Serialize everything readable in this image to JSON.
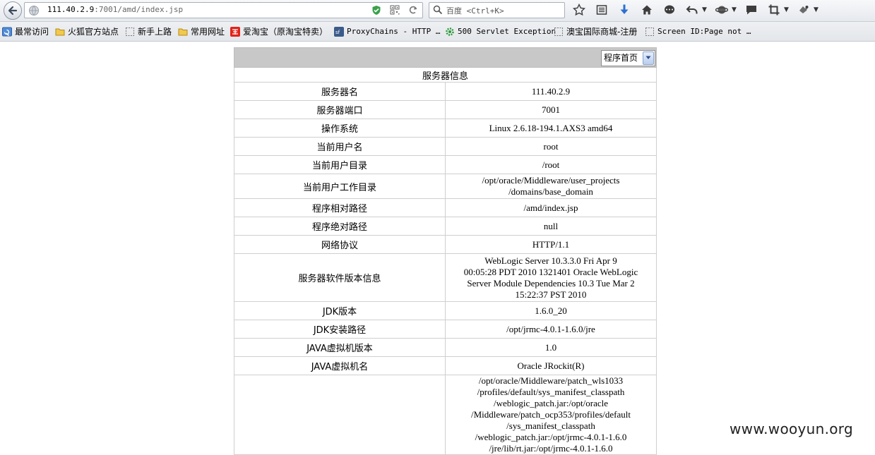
{
  "browser": {
    "url_host": "111.40.2.9",
    "url_path": ":7001/amd/index.jsp",
    "search_placeholder": "百度 <Ctrl+K>"
  },
  "bookmarks": [
    {
      "label": "最常访问",
      "icon": "bookmark-blue-icon"
    },
    {
      "label": "火狐官方站点",
      "icon": "folder-icon"
    },
    {
      "label": "新手上路",
      "icon": "page-icon"
    },
    {
      "label": "常用网址",
      "icon": "folder-icon"
    },
    {
      "label": "爱淘宝（原淘宝特卖）",
      "icon": "taobao-icon"
    },
    {
      "label": "ProxyChains - HTTP …",
      "icon": "sf-icon"
    },
    {
      "label": "500 Servlet Exception",
      "icon": "gear-green-icon"
    },
    {
      "label": "澳宝国际商城-注册",
      "icon": "page-icon"
    },
    {
      "label": "Screen ID:Page not …",
      "icon": "page-icon"
    }
  ],
  "page": {
    "select_value": "程序首页",
    "table_title": "服务器信息",
    "rows": [
      {
        "label": "服务器名",
        "value": "111.40.2.9"
      },
      {
        "label": "服务器端口",
        "value": "7001"
      },
      {
        "label": "操作系统",
        "value": "Linux 2.6.18-194.1.AXS3 amd64"
      },
      {
        "label": "当前用户名",
        "value": "root"
      },
      {
        "label": "当前用户目录",
        "value": "/root"
      },
      {
        "label": "当前用户工作目录",
        "value_lines": [
          "/opt/oracle/Middleware/user_projects",
          "/domains/base_domain"
        ]
      },
      {
        "label": "程序相对路径",
        "value": "/amd/index.jsp"
      },
      {
        "label": "程序绝对路径",
        "value": "null"
      },
      {
        "label": "网络协议",
        "value": "HTTP/1.1"
      },
      {
        "label": "服务器软件版本信息",
        "value_lines": [
          "WebLogic Server 10.3.3.0 Fri Apr 9",
          "00:05:28 PDT 2010 1321401 Oracle WebLogic",
          "Server Module Dependencies 10.3 Tue Mar 2",
          "15:22:37 PST 2010"
        ]
      },
      {
        "label": "JDK版本",
        "value": "1.6.0_20"
      },
      {
        "label": "JDK安装路径",
        "value": "/opt/jrmc-4.0.1-1.6.0/jre"
      },
      {
        "label": "JAVA虚拟机版本",
        "value": "1.0"
      },
      {
        "label": "JAVA虚拟机名",
        "value": "Oracle JRockit(R)"
      },
      {
        "label": "",
        "value_lines": [
          "/opt/oracle/Middleware/patch_wls1033",
          "/profiles/default/sys_manifest_classpath",
          "/weblogic_patch.jar:/opt/oracle",
          "/Middleware/patch_ocp353/profiles/default",
          "/sys_manifest_classpath",
          "/weblogic_patch.jar:/opt/jrmc-4.0.1-1.6.0",
          "/jre/lib/rt.jar:/opt/jrmc-4.0.1-1.6.0"
        ]
      }
    ]
  },
  "watermark": "www.wooyun.org"
}
